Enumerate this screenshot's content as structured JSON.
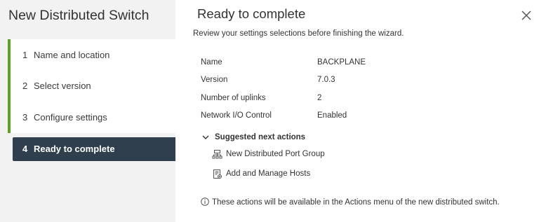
{
  "wizard": {
    "title": "New Distributed Switch",
    "steps": [
      {
        "num": "1",
        "label": "Name and location"
      },
      {
        "num": "2",
        "label": "Select version"
      },
      {
        "num": "3",
        "label": "Configure settings"
      },
      {
        "num": "4",
        "label": "Ready to complete"
      }
    ],
    "active_step": 4
  },
  "page": {
    "title": "Ready to complete",
    "subtitle": "Review your settings selections before finishing the wizard."
  },
  "summary": [
    {
      "label": "Name",
      "value": "BACKPLANE"
    },
    {
      "label": "Version",
      "value": "7.0.3"
    },
    {
      "label": "Number of uplinks",
      "value": "2"
    },
    {
      "label": "Network I/O Control",
      "value": "Enabled"
    }
  ],
  "next_actions": {
    "header": "Suggested next actions",
    "expanded": true,
    "items": [
      {
        "label": "New Distributed Port Group",
        "icon": "port-group-icon"
      },
      {
        "label": "Add and Manage Hosts",
        "icon": "manage-hosts-icon"
      }
    ]
  },
  "note": {
    "icon": "info-icon",
    "text": "These actions will be available in the Actions menu of the new distributed switch."
  },
  "colors": {
    "sidebar_bg": "#f2f2f2",
    "step_complete_accent": "#5aa220",
    "step_active_bg": "#2f3f4e"
  }
}
